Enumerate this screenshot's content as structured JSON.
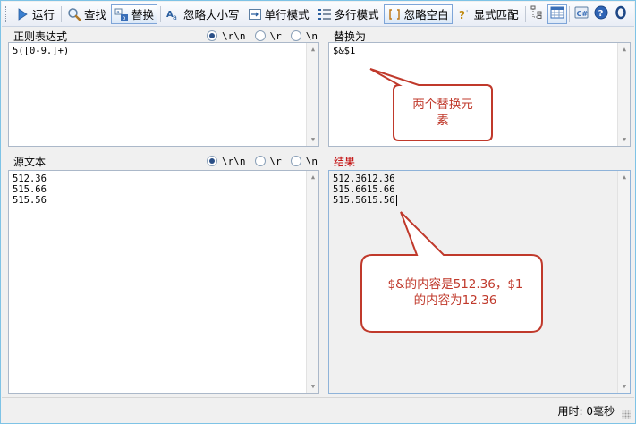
{
  "toolbar": {
    "run": "运行",
    "find": "查找",
    "replace": "替换",
    "ignore_case": "忽略大小写",
    "single_line": "单行模式",
    "multi_line": "多行模式",
    "ignore_whitespace": "忽略空白",
    "explicit_capture": "显式匹配"
  },
  "regex_pane": {
    "title": "正则表达式",
    "options": [
      "\\r\\n",
      "\\r",
      "\\n"
    ],
    "selected": 0,
    "lines": [
      "5([0-9.]+)"
    ]
  },
  "replace_pane": {
    "title": "替换为",
    "lines": [
      "$&$1"
    ]
  },
  "source_pane": {
    "title": "源文本",
    "options": [
      "\\r\\n",
      "\\r",
      "\\n"
    ],
    "selected": 0,
    "lines": [
      "512.36",
      "515.66",
      "515.56"
    ]
  },
  "result_pane": {
    "title": "结果",
    "lines": [
      "512.3612.36",
      "515.6615.66",
      "515.5615.56"
    ]
  },
  "status": {
    "elapsed": "用时: 0毫秒"
  },
  "annotations": {
    "callout_top": [
      "两个替换元",
      "素"
    ],
    "callout_bottom": [
      "$&的内容是512.36，$1",
      "的内容为12.36"
    ],
    "color": "#c0392b",
    "fill": "#ffffff"
  },
  "colors": {
    "window_border": "#7ec3e6",
    "result_title": "#c00000"
  }
}
